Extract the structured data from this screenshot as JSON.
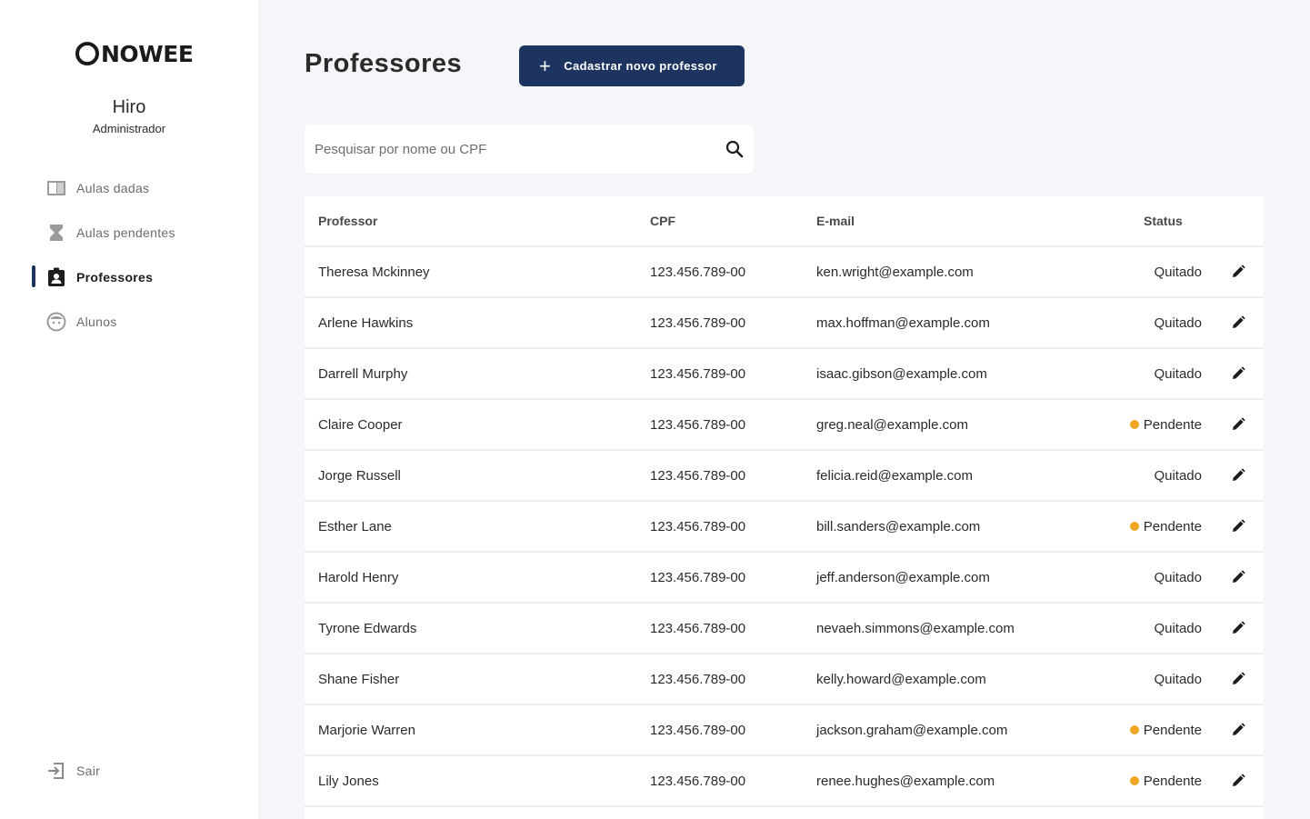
{
  "brand": {
    "logo_text": "NOWEE"
  },
  "user": {
    "name": "Hiro",
    "role": "Administrador"
  },
  "nav": {
    "items": [
      {
        "label": "Aulas dadas",
        "icon": "book-icon",
        "active": false
      },
      {
        "label": "Aulas pendentes",
        "icon": "hourglass-icon",
        "active": false
      },
      {
        "label": "Professores",
        "icon": "badge-icon",
        "active": true
      },
      {
        "label": "Alunos",
        "icon": "face-icon",
        "active": false
      }
    ],
    "logout_label": "Sair"
  },
  "header": {
    "title": "Professores",
    "add_button_label": "Cadastrar novo professor"
  },
  "search": {
    "placeholder": "Pesquisar por nome ou CPF",
    "value": ""
  },
  "table": {
    "columns": [
      "Professor",
      "CPF",
      "E-mail",
      "Status"
    ],
    "rows": [
      {
        "name": "Theresa Mckinney",
        "cpf": "123.456.789-00",
        "email": "ken.wright@example.com",
        "status": "Quitado",
        "pending": false
      },
      {
        "name": "Arlene Hawkins",
        "cpf": "123.456.789-00",
        "email": "max.hoffman@example.com",
        "status": "Quitado",
        "pending": false
      },
      {
        "name": "Darrell Murphy",
        "cpf": "123.456.789-00",
        "email": "isaac.gibson@example.com",
        "status": "Quitado",
        "pending": false
      },
      {
        "name": "Claire Cooper",
        "cpf": "123.456.789-00",
        "email": "greg.neal@example.com",
        "status": "Pendente",
        "pending": true
      },
      {
        "name": "Jorge Russell",
        "cpf": "123.456.789-00",
        "email": "felicia.reid@example.com",
        "status": "Quitado",
        "pending": false
      },
      {
        "name": "Esther Lane",
        "cpf": "123.456.789-00",
        "email": "bill.sanders@example.com",
        "status": "Pendente",
        "pending": true
      },
      {
        "name": "Harold Henry",
        "cpf": "123.456.789-00",
        "email": "jeff.anderson@example.com",
        "status": "Quitado",
        "pending": false
      },
      {
        "name": "Tyrone Edwards",
        "cpf": "123.456.789-00",
        "email": "nevaeh.simmons@example.com",
        "status": "Quitado",
        "pending": false
      },
      {
        "name": "Shane Fisher",
        "cpf": "123.456.789-00",
        "email": "kelly.howard@example.com",
        "status": "Quitado",
        "pending": false
      },
      {
        "name": "Marjorie Warren",
        "cpf": "123.456.789-00",
        "email": "jackson.graham@example.com",
        "status": "Pendente",
        "pending": true
      },
      {
        "name": "Lily Jones",
        "cpf": "123.456.789-00",
        "email": "renee.hughes@example.com",
        "status": "Pendente",
        "pending": true
      }
    ]
  },
  "colors": {
    "accent": "#1d3461",
    "pending_dot": "#f5a623",
    "background": "#f5f6fa"
  }
}
